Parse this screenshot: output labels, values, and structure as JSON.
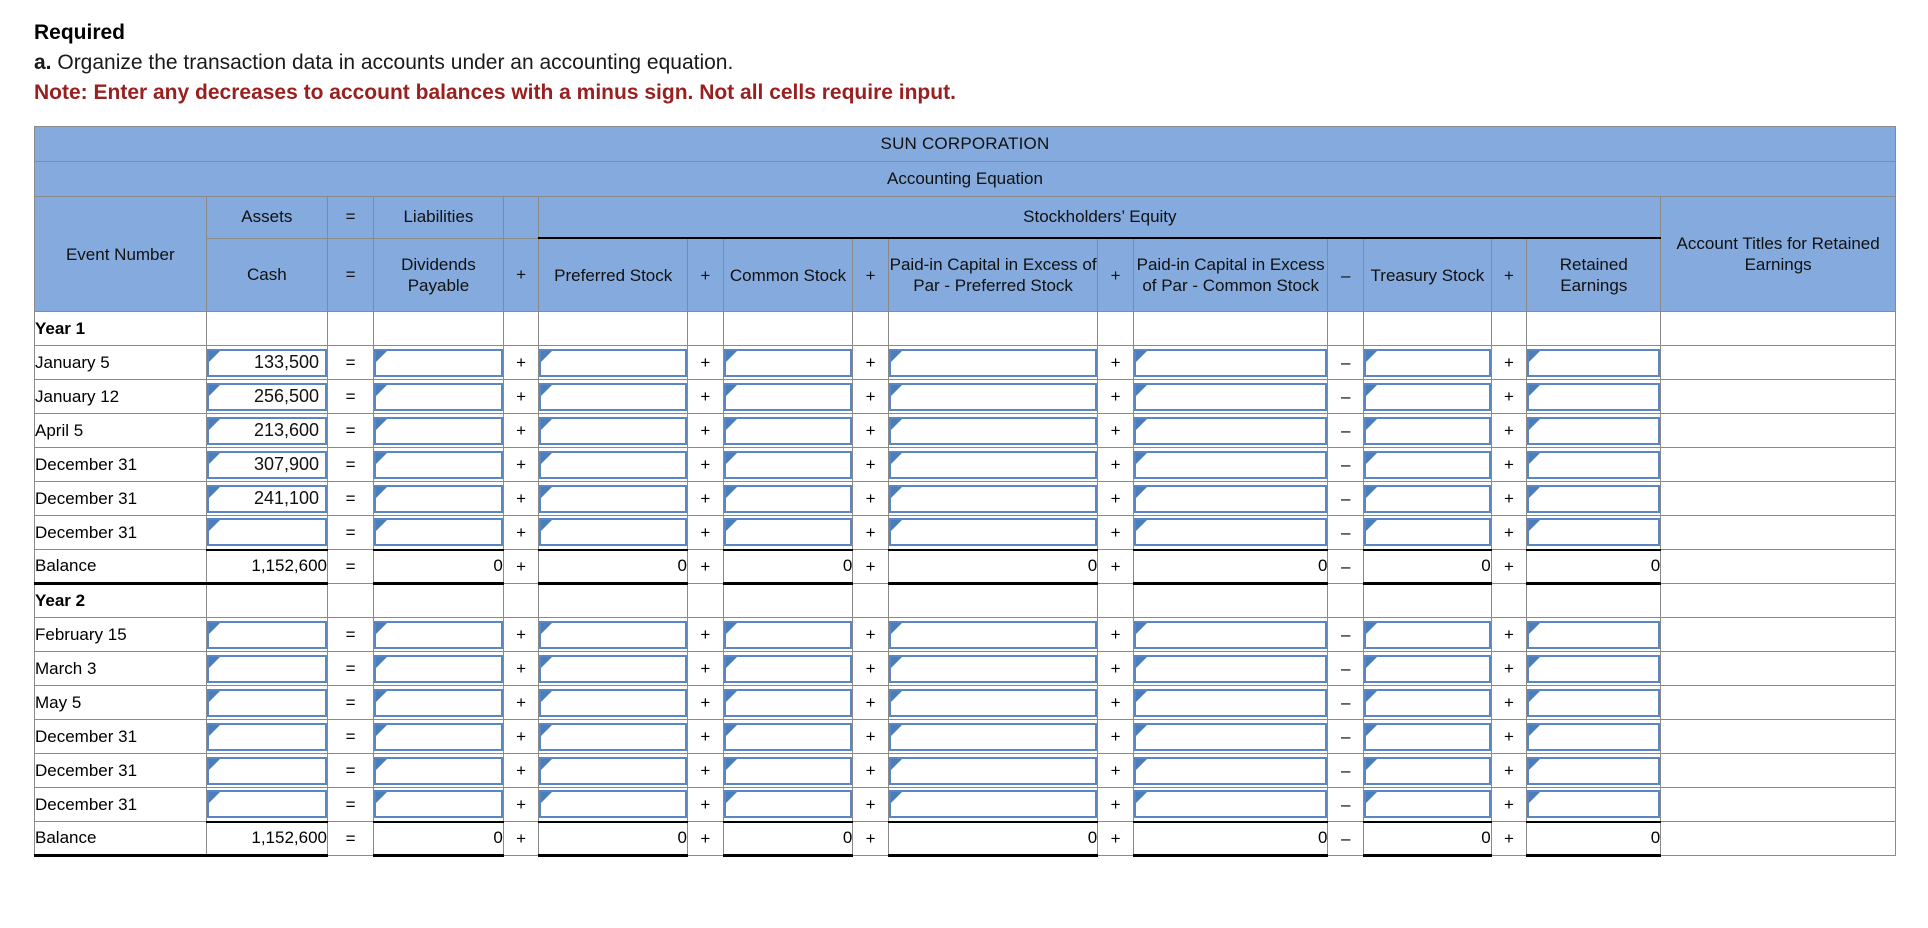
{
  "instructions": {
    "title": "Required",
    "item_lead": "a.",
    "item_text": "Organize the transaction data in accounts under an accounting equation.",
    "note": "Note: Enter any decreases to account balances with a minus sign. Not all cells require input."
  },
  "worksheet": {
    "company": "SUN CORPORATION",
    "subtitle": "Accounting Equation",
    "group_headers": {
      "event_number": "Event Number",
      "assets": "Assets",
      "equals": "=",
      "liabilities": "Liabilities",
      "stockholders_equity": "Stockholders’ Equity",
      "account_titles": "Account Titles for Retained Earnings"
    },
    "columns": [
      {
        "label": "Cash",
        "kind": "amount"
      },
      {
        "label": "=",
        "kind": "op"
      },
      {
        "label": "Dividends Payable",
        "kind": "amount"
      },
      {
        "label": "+",
        "kind": "op"
      },
      {
        "label": "Preferred Stock",
        "kind": "amount"
      },
      {
        "label": "+",
        "kind": "op"
      },
      {
        "label": "Common Stock",
        "kind": "amount"
      },
      {
        "label": "+",
        "kind": "op"
      },
      {
        "label": "Paid-in Capital in Excess of Par - Preferred Stock",
        "kind": "amount"
      },
      {
        "label": "+",
        "kind": "op"
      },
      {
        "label": "Paid-in Capital in Excess of Par - Common Stock",
        "kind": "amount"
      },
      {
        "label": "–",
        "kind": "op"
      },
      {
        "label": "Treasury Stock",
        "kind": "amount"
      },
      {
        "label": "+",
        "kind": "op"
      },
      {
        "label": "Retained Earnings",
        "kind": "amount"
      }
    ],
    "rows": [
      {
        "event": "Year 1",
        "type": "section",
        "cells": [
          "",
          "",
          "",
          "",
          "",
          "",
          "",
          "",
          "",
          "",
          "",
          "",
          "",
          "",
          ""
        ],
        "account_title": ""
      },
      {
        "event": "January 5",
        "type": "input",
        "cells": [
          "133,500",
          "=",
          "",
          "+",
          "",
          "+",
          "",
          "+",
          "",
          "+",
          "",
          "–",
          "",
          "+",
          ""
        ],
        "account_title": ""
      },
      {
        "event": "January 12",
        "type": "input",
        "cells": [
          "256,500",
          "=",
          "",
          "+",
          "",
          "+",
          "",
          "+",
          "",
          "+",
          "",
          "–",
          "",
          "+",
          ""
        ],
        "account_title": ""
      },
      {
        "event": "April 5",
        "type": "input",
        "cells": [
          "213,600",
          "=",
          "",
          "+",
          "",
          "+",
          "",
          "+",
          "",
          "+",
          "",
          "–",
          "",
          "+",
          ""
        ],
        "account_title": ""
      },
      {
        "event": "December 31",
        "type": "input",
        "cells": [
          "307,900",
          "=",
          "",
          "+",
          "",
          "+",
          "",
          "+",
          "",
          "+",
          "",
          "–",
          "",
          "+",
          ""
        ],
        "account_title": ""
      },
      {
        "event": "December 31",
        "type": "input",
        "cells": [
          "241,100",
          "=",
          "",
          "+",
          "",
          "+",
          "",
          "+",
          "",
          "+",
          "",
          "–",
          "",
          "+",
          ""
        ],
        "account_title": ""
      },
      {
        "event": "December 31",
        "type": "input-last",
        "cells": [
          "",
          "=",
          "",
          "+",
          "",
          "+",
          "",
          "+",
          "",
          "+",
          "",
          "–",
          "",
          "+",
          ""
        ],
        "account_title": ""
      },
      {
        "event": "Balance",
        "type": "balance",
        "cells": [
          "1,152,600",
          "=",
          "0",
          "+",
          "0",
          "+",
          "0",
          "+",
          "0",
          "+",
          "0",
          "–",
          "0",
          "+",
          "0"
        ],
        "account_title": ""
      },
      {
        "event": "Year 2",
        "type": "section",
        "cells": [
          "",
          "",
          "",
          "",
          "",
          "",
          "",
          "",
          "",
          "",
          "",
          "",
          "",
          "",
          ""
        ],
        "account_title": ""
      },
      {
        "event": "February 15",
        "type": "input",
        "cells": [
          "",
          "=",
          "",
          "+",
          "",
          "+",
          "",
          "+",
          "",
          "+",
          "",
          "–",
          "",
          "+",
          ""
        ],
        "account_title": ""
      },
      {
        "event": "March 3",
        "type": "input",
        "cells": [
          "",
          "=",
          "",
          "+",
          "",
          "+",
          "",
          "+",
          "",
          "+",
          "",
          "–",
          "",
          "+",
          ""
        ],
        "account_title": ""
      },
      {
        "event": "May 5",
        "type": "input",
        "cells": [
          "",
          "=",
          "",
          "+",
          "",
          "+",
          "",
          "+",
          "",
          "+",
          "",
          "–",
          "",
          "+",
          ""
        ],
        "account_title": ""
      },
      {
        "event": "December 31",
        "type": "input",
        "cells": [
          "",
          "=",
          "",
          "+",
          "",
          "+",
          "",
          "+",
          "",
          "+",
          "",
          "–",
          "",
          "+",
          ""
        ],
        "account_title": ""
      },
      {
        "event": "December 31",
        "type": "input",
        "cells": [
          "",
          "=",
          "",
          "+",
          "",
          "+",
          "",
          "+",
          "",
          "+",
          "",
          "–",
          "",
          "+",
          ""
        ],
        "account_title": ""
      },
      {
        "event": "December 31",
        "type": "input-last",
        "cells": [
          "",
          "=",
          "",
          "+",
          "",
          "+",
          "",
          "+",
          "",
          "+",
          "",
          "–",
          "",
          "+",
          ""
        ],
        "account_title": ""
      },
      {
        "event": "Balance",
        "type": "balance",
        "cells": [
          "1,152,600",
          "=",
          "0",
          "+",
          "0",
          "+",
          "0",
          "+",
          "0",
          "+",
          "0",
          "–",
          "0",
          "+",
          "0"
        ],
        "account_title": ""
      }
    ]
  },
  "colors": {
    "header_blue": "#84aade",
    "input_border": "#5b86c4",
    "note_red": "#9a2020",
    "grid": "#8a8a8a"
  }
}
